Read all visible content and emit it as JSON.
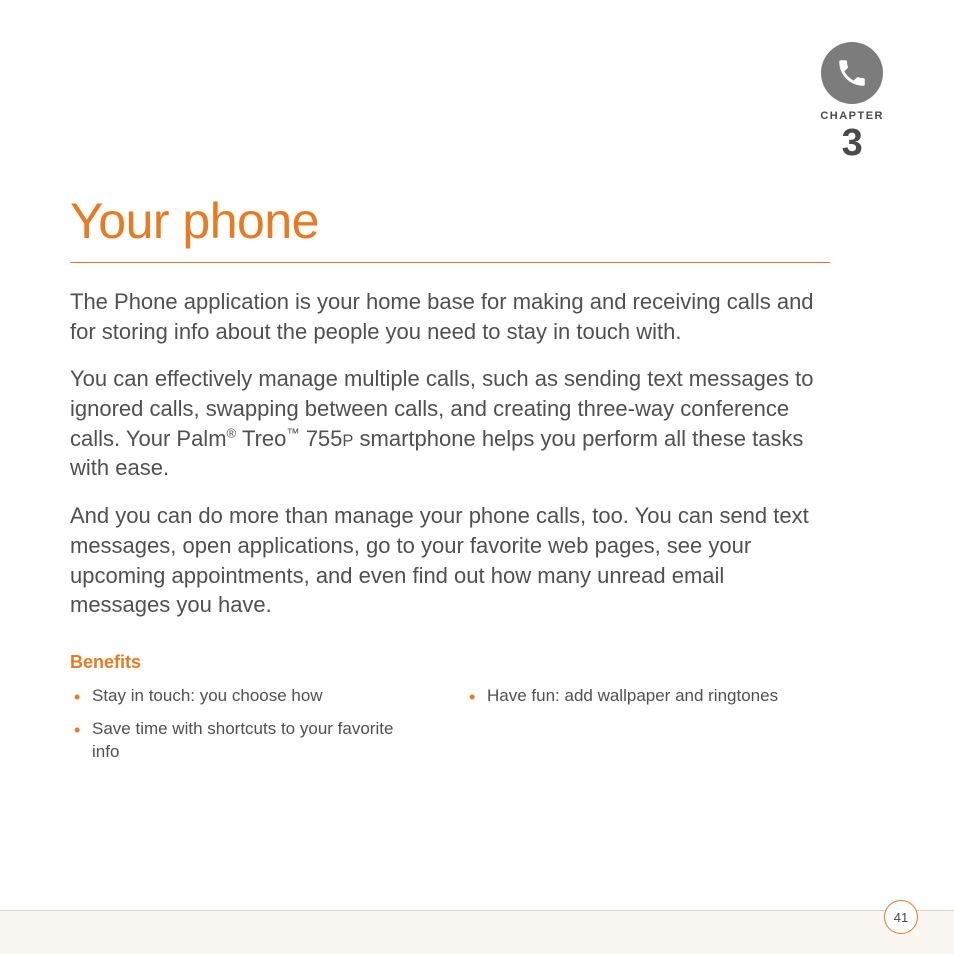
{
  "chapter": {
    "label": "CHAPTER",
    "number": "3",
    "icon": "phone-icon"
  },
  "title": "Your phone",
  "paragraphs": {
    "p1": "The Phone application is your home base for making and receiving calls and for storing info about the people you need to stay in touch with.",
    "p2_pre": "You can effectively manage multiple calls, such as sending text messages to ignored calls, swapping between calls, and creating three-way conference calls. Your Palm",
    "p2_reg": "®",
    "p2_mid": " Treo",
    "p2_tm": "™",
    "p2_mid2": " 755",
    "p2_small": "P",
    "p2_post": " smartphone helps you perform all these tasks with ease.",
    "p3": "And you can do more than manage your phone calls, too. You can send text messages, open applications, go to your favorite web pages, see your upcoming appointments, and even find out how many unread email messages you have."
  },
  "benefits": {
    "heading": "Benefits",
    "left": [
      "Stay in touch: you choose how",
      "Save time with shortcuts to your favorite info"
    ],
    "right": [
      "Have fun: add wallpaper and ringtones"
    ]
  },
  "page_number": "41"
}
